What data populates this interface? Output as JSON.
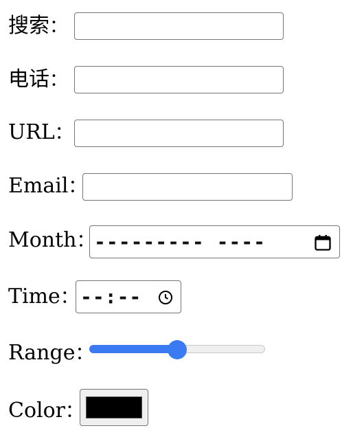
{
  "form": {
    "search": {
      "label": "搜索",
      "value": "",
      "placeholder": ""
    },
    "phone": {
      "label": "电话",
      "value": "",
      "placeholder": ""
    },
    "url": {
      "label": "URL",
      "value": "",
      "placeholder": ""
    },
    "email": {
      "label": "Email",
      "value": "",
      "placeholder": ""
    },
    "month": {
      "label": "Month",
      "display": "---------  ----",
      "icon": "calendar-icon"
    },
    "time": {
      "label": "Time",
      "display": "--:--",
      "icon": "clock-icon"
    },
    "range": {
      "label": "Range",
      "value": 0.5,
      "accent": "#3a7af3"
    },
    "color": {
      "label": "Color",
      "value": "#000000"
    },
    "separator": "："
  }
}
